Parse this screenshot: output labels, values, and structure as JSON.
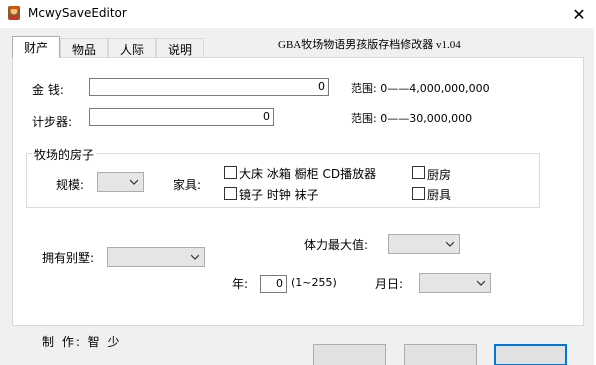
{
  "window": {
    "title": "McwySaveEditor",
    "close_glyph": "✕"
  },
  "tabs": [
    {
      "label": "财产",
      "active": true
    },
    {
      "label": "物品",
      "active": false
    },
    {
      "label": "人际",
      "active": false
    },
    {
      "label": "说明",
      "active": false
    }
  ],
  "header": {
    "version_text": "GBA牧场物语男孩版存档修改器  v1.04"
  },
  "money": {
    "label": "金  钱:",
    "value": "0",
    "range_text": "范围: 0——4,000,000,000"
  },
  "pedometer": {
    "label": "计步器:",
    "value": "0",
    "range_text": "范围: 0——30,000,000"
  },
  "ranch_house": {
    "group_title": "牧场的房子",
    "scale_label": "规模:",
    "scale_value": "",
    "furniture_label": "家具:",
    "furniture": [
      {
        "label": "大床 冰箱 橱柜 CD播放器",
        "checked": false
      },
      {
        "label": "厨房",
        "checked": false
      },
      {
        "label": "镜子 时钟 袜子",
        "checked": false
      },
      {
        "label": "厨具",
        "checked": false
      }
    ]
  },
  "villa": {
    "label": "拥有别墅:",
    "value": ""
  },
  "stamina": {
    "label": "体力最大值:",
    "value": ""
  },
  "year": {
    "label": "年:",
    "value": "0",
    "hint": "(1~255)"
  },
  "month_day": {
    "label": "月日:",
    "value": ""
  },
  "footer": {
    "credit": "制 作: 智 少"
  }
}
